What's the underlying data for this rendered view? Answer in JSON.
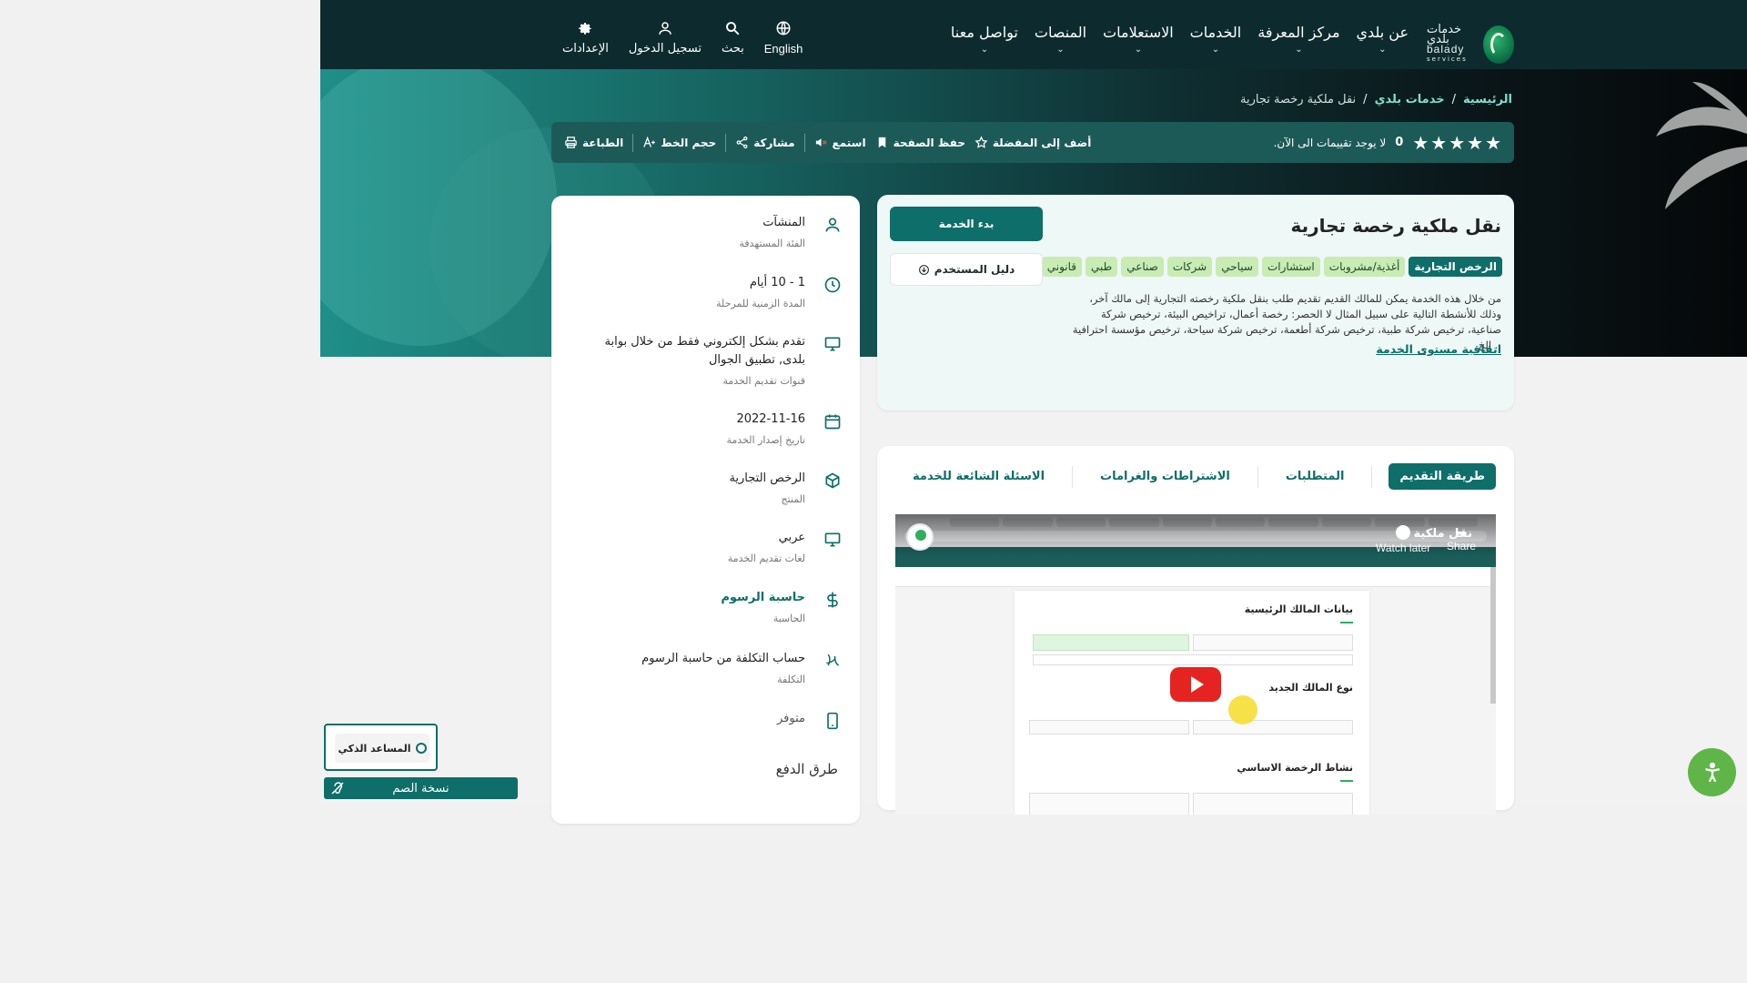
{
  "nav": {
    "logo": {
      "ar": "خدمات بلدي",
      "en": "balady",
      "sub": "services"
    },
    "menu": [
      {
        "label": "عن بلدي"
      },
      {
        "label": "مركز المعرفة"
      },
      {
        "label": "الخدمات"
      },
      {
        "label": "الاستعلامات"
      },
      {
        "label": "المنصات"
      },
      {
        "label": "تواصل معنا"
      }
    ],
    "tools": {
      "language": "English",
      "search": "بحث",
      "login": "تسجيل الدخول",
      "settings": "الإعدادات"
    }
  },
  "breadcrumb": {
    "home": "الرئيسية",
    "section": "خدمات بلدي",
    "current": "نقل ملكية رخصة تجارية",
    "sep": "/"
  },
  "actionbar": {
    "stars": 5,
    "rating_count": "0",
    "rating_text": "لا يوجد تقييمات الى الآن.",
    "add_favorite": "أضف إلى المفضلة",
    "save_page": "حفظ الصفحة",
    "listen": "استمع",
    "share": "مشاركة",
    "font_size": "حجم الخط",
    "print": "الطباعة"
  },
  "service": {
    "title": "نقل ملكية رخصة تجارية",
    "tags": [
      "الرخص التجارية",
      "أغذية/مشروبات",
      "استشارات",
      "سياحي",
      "شركات",
      "صناعي",
      "طبي",
      "قانوني"
    ],
    "description": "من خلال هذه الخدمة يمكن للمالك القديم تقديم طلب بنقل ملكية رخصته التجارية إلى مالك آخر، وذلك للأنشطة التالية على سبيل المثال لا الحصر: رخصة أعمال، تراخيص البيئة، ترخيص شركة صناعية، ترخيص شركة طبية، ترخيص شركة أطعمة، ترخيص شركة سياحة، ترخيص مؤسسة احترافية .. إلخ.",
    "sla_link": "اتفاقية مستوى الخدمة",
    "start_button": "بدء الخدمة",
    "guide_button": "دليل المستخدم"
  },
  "info": [
    {
      "icon": "user-icon",
      "value": "المنشآت",
      "label": "الفئة المستهدفة"
    },
    {
      "icon": "clock-icon",
      "value": "1 - 10 أيام",
      "label": "المدة الزمنية للمرحلة"
    },
    {
      "icon": "monitor-icon",
      "value": "تقدم بشكل إلكتروني فقط من خلال بوابة بلدى, تطبيق الجوال",
      "label": "قنوات تقديم الخدمة"
    },
    {
      "icon": "calendar-icon",
      "value": "2022-11-16",
      "label": "تاريخ إصدار الخدمة"
    },
    {
      "icon": "box-icon",
      "value": "الرخص التجارية",
      "label": "المنتج"
    },
    {
      "icon": "monitor-icon",
      "value": "عربي",
      "label": "لغات تقديم الخدمة"
    },
    {
      "icon": "dollar-icon",
      "value": "حاسبة الرسوم",
      "label": "الحاسبة"
    },
    {
      "icon": "riyal-icon",
      "value": "حساب التكلفة من حاسبة الرسوم",
      "label": "التكلفة"
    },
    {
      "icon": "mobile-icon",
      "value": "متوفر",
      "label": ""
    }
  ],
  "payment_title": "طرق الدفع",
  "tabs": [
    {
      "label": "طريقة التقديم",
      "active": true
    },
    {
      "label": "المتطلبات"
    },
    {
      "label": "الاشتراطات والغرامات"
    },
    {
      "label": "الاسئلة الشائعة للخدمة"
    }
  ],
  "video": {
    "title": "نقل ملكية",
    "watch_later": "Watch later",
    "share": "Share",
    "owner_heading": "بيانات المالك الرئيسية",
    "new_owner_heading": "نوع المالك الجديد",
    "activity_heading": "نشاط الرخصة الاساسي"
  },
  "floating": {
    "assistant": "المساعد الذكي",
    "deaf_version": "نسخة الصم"
  },
  "colors": {
    "primary": "#0e6e69",
    "nav": "#0d2b2e",
    "tag": "#c9ebb4",
    "access": "#5fb548"
  }
}
